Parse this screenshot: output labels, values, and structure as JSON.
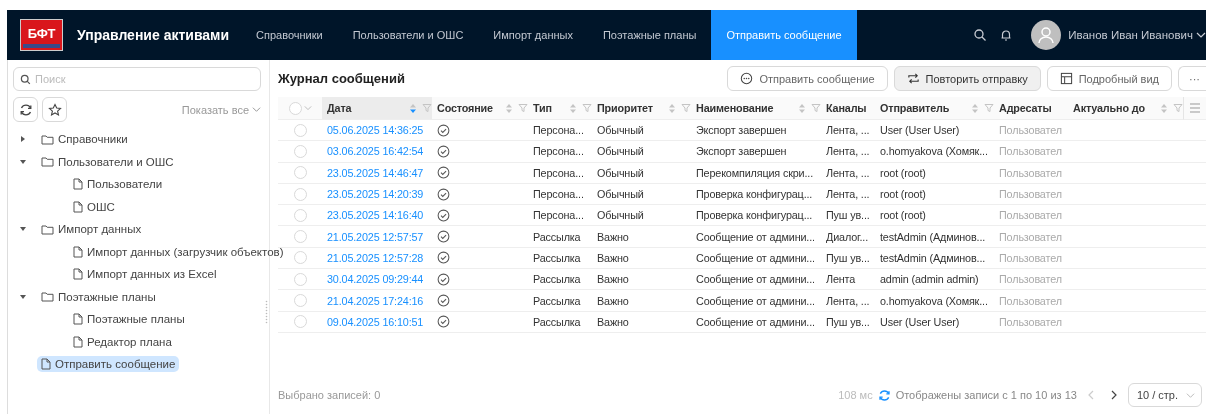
{
  "app": {
    "logo": "БФТ",
    "title": "Управление активами"
  },
  "nav": [
    {
      "label": "Справочники",
      "selected": false
    },
    {
      "label": "Пользователи и ОШС",
      "selected": false
    },
    {
      "label": "Импорт данных",
      "selected": false
    },
    {
      "label": "Поэтажные планы",
      "selected": false
    },
    {
      "label": "Отправить сообщение",
      "selected": true
    }
  ],
  "user": {
    "name": "Иванов Иван Иванович"
  },
  "sidebar": {
    "search": {
      "placeholder": "Поиск"
    },
    "show_all": "Показать все",
    "tree": [
      {
        "label": "Справочники",
        "kind": "folder",
        "expanded": false,
        "selected": false
      },
      {
        "label": "Пользователи и ОШС",
        "kind": "folder",
        "expanded": true,
        "selected": false,
        "children": [
          {
            "label": "Пользователи",
            "kind": "page",
            "selected": false
          },
          {
            "label": "ОШС",
            "kind": "page",
            "selected": false
          }
        ]
      },
      {
        "label": "Импорт данных",
        "kind": "folder",
        "expanded": true,
        "selected": false,
        "children": [
          {
            "label": "Импорт данных (загрузчик объектов)",
            "kind": "page",
            "selected": false
          },
          {
            "label": "Импорт данных из Excel",
            "kind": "page",
            "selected": false
          }
        ]
      },
      {
        "label": "Поэтажные планы",
        "kind": "folder",
        "expanded": true,
        "selected": false,
        "children": [
          {
            "label": "Поэтажные планы",
            "kind": "page",
            "selected": false
          },
          {
            "label": "Редактор плана",
            "kind": "page",
            "selected": false
          }
        ]
      },
      {
        "label": "Отправить сообщение",
        "kind": "page",
        "selected": true
      }
    ]
  },
  "journal": {
    "title": "Журнал сообщений",
    "toolbar": [
      {
        "label": "Отправить сообщение",
        "kind": "message",
        "highlighted": false
      },
      {
        "label": "Повторить отправку",
        "kind": "repeat",
        "highlighted": true
      },
      {
        "label": "Подробный вид",
        "kind": "detail",
        "highlighted": false
      },
      {
        "label": "···",
        "kind": "more",
        "highlighted": false
      }
    ],
    "select_all": {
      "checked": false
    },
    "columns": [
      {
        "label": "Дата",
        "kind": "sortable",
        "sorted": true
      },
      {
        "label": "Состояние",
        "kind": "sortable",
        "sorted": false
      },
      {
        "label": "Тип",
        "kind": "sortable",
        "sorted": false
      },
      {
        "label": "Приоритет",
        "kind": "sortable",
        "sorted": false
      },
      {
        "label": "Наименование",
        "kind": "sortable",
        "sorted": false
      },
      {
        "label": "Каналы",
        "kind": "plain",
        "sorted": false
      },
      {
        "label": "Отправитель",
        "kind": "sortable",
        "sorted": false
      },
      {
        "label": "Адресаты",
        "kind": "plain",
        "sorted": false
      },
      {
        "label": "Актуально до",
        "kind": "sortable",
        "sorted": false
      }
    ],
    "rows": [
      {
        "selected": false,
        "date": "05.06.2025 14:36:25",
        "type": "Персона...",
        "priority": "Обычный",
        "name": "Экспорт завершен",
        "channels": "Лента, ...",
        "sender": "User (User User)",
        "recipients": "Пользовател"
      },
      {
        "selected": false,
        "date": "03.06.2025 16:42:54",
        "type": "Персона...",
        "priority": "Обычный",
        "name": "Экспорт завершен",
        "channels": "Лента, ...",
        "sender": "o.homyakova (Хомяк...",
        "recipients": "Пользовател"
      },
      {
        "selected": false,
        "date": "23.05.2025 14:46:47",
        "type": "Персона...",
        "priority": "Обычный",
        "name": "Перекомпиляция скри...",
        "channels": "Лента, ...",
        "sender": "root (root)",
        "recipients": "Пользовател"
      },
      {
        "selected": false,
        "date": "23.05.2025 14:20:39",
        "type": "Персона...",
        "priority": "Обычный",
        "name": "Проверка конфигурац...",
        "channels": "Лента, ...",
        "sender": "root (root)",
        "recipients": "Пользовател"
      },
      {
        "selected": false,
        "date": "23.05.2025 14:16:40",
        "type": "Персона...",
        "priority": "Обычный",
        "name": "Проверка конфигурац...",
        "channels": "Пуш ув...",
        "sender": "root (root)",
        "recipients": "Пользовател"
      },
      {
        "selected": false,
        "date": "21.05.2025 12:57:57",
        "type": "Рассылка",
        "priority": "Важно",
        "name": "Сообщение от админи...",
        "channels": "Диалог...",
        "sender": "testAdmin (Админов...",
        "recipients": "Пользовател"
      },
      {
        "selected": false,
        "date": "21.05.2025 12:57:28",
        "type": "Рассылка",
        "priority": "Важно",
        "name": "Сообщение от админи...",
        "channels": "Пуш ув...",
        "sender": "testAdmin (Админов...",
        "recipients": "Пользовател"
      },
      {
        "selected": false,
        "date": "30.04.2025 09:29:44",
        "type": "Рассылка",
        "priority": "Важно",
        "name": "Сообщение от админи...",
        "channels": "Лента",
        "sender": "admin (admin admin)",
        "recipients": "Пользовател"
      },
      {
        "selected": false,
        "date": "21.04.2025 17:24:16",
        "type": "Рассылка",
        "priority": "Важно",
        "name": "Сообщение от админи...",
        "channels": "Лента, ...",
        "sender": "o.homyakova (Хомяк...",
        "recipients": "Пользовател"
      },
      {
        "selected": false,
        "date": "09.04.2025 16:10:51",
        "type": "Рассылка",
        "priority": "Важно",
        "name": "Сообщение от админи...",
        "channels": "Пуш ув...",
        "sender": "User (User User)",
        "recipients": "Пользовател"
      }
    ]
  },
  "footer": {
    "selected_count": "Выбрано записей: 0",
    "timing": "108 мс",
    "range": "Отображены записи с 1 по 10 из 13",
    "page_size": "10 / стр."
  }
}
